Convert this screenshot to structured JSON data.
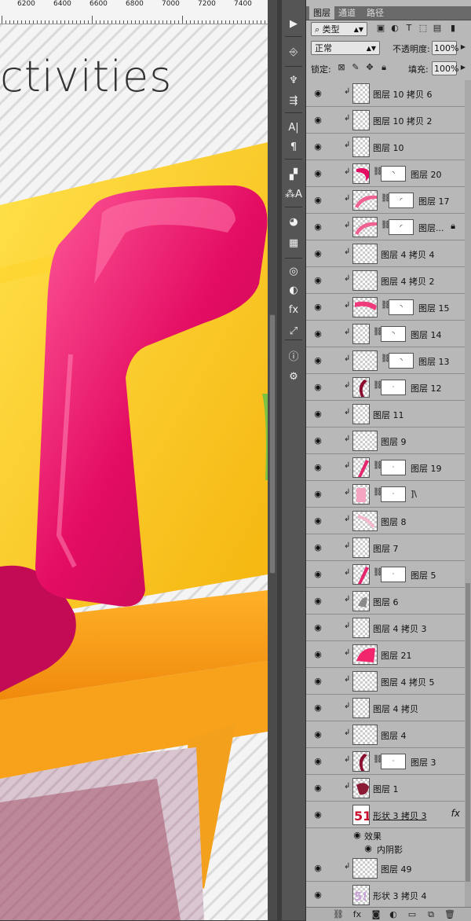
{
  "ruler": {
    "ticks": [
      "6200",
      "6400",
      "6600",
      "6800",
      "7000",
      "7200",
      "7400"
    ]
  },
  "canvas": {
    "headline": "ctivities"
  },
  "tool_strip": {
    "tools": [
      "play-icon",
      "paragraph-layout-icon",
      "brush-preset-icon",
      "adjust-icon",
      "character-icon",
      "paragraph-icon",
      "styles-icon",
      "char-styles-icon",
      "palette-icon",
      "grid-icon",
      "layer-comps-icon",
      "gradient-icon",
      "fx-icon",
      "transform-icon",
      "info-icon",
      "properties-icon"
    ]
  },
  "panel": {
    "tabs": [
      "图层",
      "通道",
      "路径"
    ],
    "active_tab": 0,
    "filter_label": "类型",
    "blend_mode": "正常",
    "opacity_label": "不透明度:",
    "opacity_value": "100%",
    "lock_label": "锁定:",
    "fill_label": "填充:",
    "fill_value": "100%"
  },
  "layers": [
    {
      "name": "图层 10 拷贝 6",
      "clip": true,
      "thumb": "empty",
      "mask": false
    },
    {
      "name": "图层 10 拷贝 2",
      "clip": true,
      "thumb": "empty",
      "mask": false
    },
    {
      "name": "图层 10",
      "clip": true,
      "thumb": "empty",
      "mask": false
    },
    {
      "name": "图层 20",
      "clip": true,
      "thumb": "pink-arc",
      "mask": true,
      "mask_mark": "◝"
    },
    {
      "name": "图层 17",
      "clip": true,
      "thumb": "pink-curve",
      "mask": true,
      "mask_mark": "◜",
      "wide": true
    },
    {
      "name": "图层...",
      "clip": true,
      "thumb": "pink-curve",
      "mask": true,
      "mask_mark": "◜",
      "wide": true,
      "locked": true
    },
    {
      "name": "图层 4 拷贝 4",
      "clip": true,
      "thumb": "empty",
      "mask": false,
      "wide": true
    },
    {
      "name": "图层 4 拷贝 2",
      "clip": true,
      "thumb": "empty",
      "mask": false,
      "wide": true
    },
    {
      "name": "图层 15",
      "clip": true,
      "thumb": "pink-band",
      "mask": true,
      "mask_mark": "◝",
      "wide": true
    },
    {
      "name": "图层 14",
      "clip": true,
      "thumb": "empty",
      "mask": true,
      "mask_mark": "◝"
    },
    {
      "name": "图层 13",
      "clip": true,
      "thumb": "empty",
      "mask": true,
      "mask_mark": "◝",
      "wide": true
    },
    {
      "name": "图层 12",
      "clip": true,
      "thumb": "dark-stroke",
      "mask": true,
      "mask_mark": "·"
    },
    {
      "name": "图层 11",
      "clip": true,
      "thumb": "empty",
      "mask": false
    },
    {
      "name": "图层 9",
      "clip": true,
      "thumb": "empty",
      "mask": false,
      "wide": true
    },
    {
      "name": "图层 19",
      "clip": true,
      "thumb": "pink-stroke",
      "mask": true,
      "mask_mark": "·"
    },
    {
      "name": "]\\",
      "clip": true,
      "thumb": "light-pink",
      "mask": true,
      "mask_mark": "·"
    },
    {
      "name": "图层 8",
      "clip": true,
      "thumb": "faint-pink",
      "mask": false,
      "wide": true
    },
    {
      "name": "图层 7",
      "clip": true,
      "thumb": "empty",
      "mask": false
    },
    {
      "name": "图层 5",
      "clip": true,
      "thumb": "pink-stroke",
      "mask": true,
      "mask_mark": "·"
    },
    {
      "name": "图层 6",
      "clip": true,
      "thumb": "gray-smudge",
      "mask": false
    },
    {
      "name": "图层 4 拷贝 3",
      "clip": true,
      "thumb": "empty",
      "mask": false
    },
    {
      "name": "图层 21",
      "clip": true,
      "thumb": "pink-solid",
      "mask": false,
      "wide": true
    },
    {
      "name": "图层 4 拷贝 5",
      "clip": true,
      "thumb": "empty",
      "mask": false,
      "wide": true
    },
    {
      "name": "图层 4 拷贝",
      "clip": true,
      "thumb": "empty",
      "mask": false
    },
    {
      "name": "图层 4",
      "clip": true,
      "thumb": "empty",
      "mask": false,
      "wide": true
    },
    {
      "name": "图层 3",
      "clip": true,
      "thumb": "dark-stroke",
      "mask": true,
      "mask_mark": "·"
    },
    {
      "name": "图层 1",
      "clip": true,
      "thumb": "maroon-blob",
      "mask": false
    },
    {
      "name": "形状 3 拷贝 3",
      "clip": false,
      "thumb": "shape-51",
      "mask": false,
      "fx": true,
      "underline": true
    },
    {
      "name": "效果",
      "sub": true,
      "indent": 0
    },
    {
      "name": "内阴影",
      "sub": true,
      "indent": 1
    },
    {
      "name": "图层 49",
      "clip": true,
      "thumb": "empty",
      "mask": false,
      "wide": true
    },
    {
      "name": "形状 3 拷贝 4",
      "clip": false,
      "thumb": "shape-lilac",
      "mask": false
    }
  ],
  "bottom_bar": {
    "icons": [
      "link-icon",
      "fx-icon",
      "mask-icon",
      "adjustment-icon",
      "folder-icon",
      "new-layer-icon",
      "trash-icon"
    ]
  },
  "colors": {
    "accent_pink": "#e40d63",
    "yellow": "#f8c419",
    "orange": "#f7a21a",
    "panel_bg": "#b8b8b8"
  }
}
